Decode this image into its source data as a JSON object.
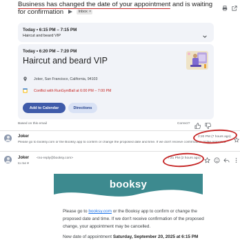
{
  "subject": {
    "underlined": "Business has changed the date of your appointment",
    "rest": " and is waiting for confirmation",
    "label_chip": "Inbox",
    "chip_close": "×"
  },
  "header_icons": [
    "print-icon",
    "open-in-new-icon"
  ],
  "event_card_old": {
    "time": "Today • 6:15 PM – 7:15 PM",
    "title": "Haircut and beard VIP"
  },
  "event_card_new": {
    "time": "Today • 6:20 PM – 7:20 PM",
    "title": "Haircut and beard VIP",
    "location": "Joker, San Francisco, California, 94103",
    "conflict": "Conflict with RunGymBall at 6:00 PM – 7:00 PM",
    "add_button": "Add to Calendar",
    "directions_button": "Directions"
  },
  "feedback": {
    "based_on": "Based on this email",
    "correct": "Correct?"
  },
  "message_1": {
    "sender": "Joker",
    "snippet": "Please go to booksy.com or the Booksy app to confirm or change the proposed date and time. If we don't receive confirmation of the proposed",
    "time": "2:20 PM (7 hours ago)"
  },
  "message_2": {
    "sender": "Joker",
    "email": "<no-reply@booksy.com>",
    "to": "to me ▾",
    "time": "7:21 PM (2 hours ago)",
    "brand": "booksy",
    "body_pre": "Please go to ",
    "body_link": "booksy.com",
    "body_post": " or the Booksy app to confirm or change the proposed date and time. If we don't receive confirmation of the proposed change, your appointment may be cancelled.",
    "new_date_label": "New date of appointment ",
    "new_date_value": "Saturday, September 20, 2025 at 6:15 PM"
  },
  "colors": {
    "accent": "#3f5ba9",
    "conflict": "#c5221f",
    "annotation": "#c62828",
    "brand": "#3d8a8f"
  }
}
